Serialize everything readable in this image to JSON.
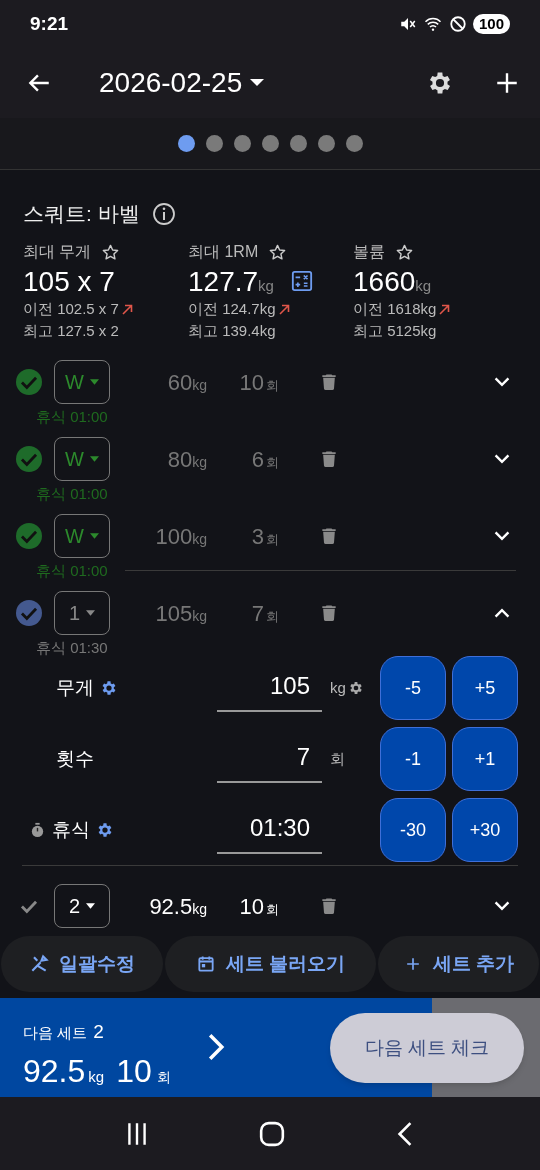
{
  "status_bar": {
    "time": "9:21",
    "battery": "100"
  },
  "app_bar": {
    "date": "2026-02-25"
  },
  "pages": [
    {
      "selected": true
    },
    {
      "selected": false
    },
    {
      "selected": false
    },
    {
      "selected": false
    },
    {
      "selected": false
    },
    {
      "selected": false
    },
    {
      "selected": false
    }
  ],
  "exercise": {
    "title": "스쿼트: 바벨"
  },
  "stats": [
    {
      "label": "최대 무게",
      "value": "105 x 7",
      "calculator": false,
      "previous": "이전 102.5 x 7",
      "best": "최고 127.5 x 2"
    },
    {
      "label": "최대 1RM",
      "value": "127.7",
      "unit": "kg",
      "calculator": true,
      "previous": "이전 124.7kg",
      "best": "최고 139.4kg"
    },
    {
      "label": "볼륨",
      "value": "1660",
      "unit": "kg",
      "calculator": false,
      "previous": "이전 1618kg",
      "best": "최고 5125kg"
    }
  ],
  "sets": [
    {
      "kind": "done",
      "type": "W",
      "weight": "60",
      "weight_unit": "kg",
      "reps": "10",
      "reps_unit": "회",
      "rest": "휴식 01:00",
      "expanded": false
    },
    {
      "kind": "done",
      "type": "W",
      "weight": "80",
      "weight_unit": "kg",
      "reps": "6",
      "reps_unit": "회",
      "rest": "휴식 01:00",
      "expanded": false
    },
    {
      "kind": "done",
      "type": "W",
      "weight": "100",
      "weight_unit": "kg",
      "reps": "3",
      "reps_unit": "회",
      "rest": "휴식 01:00",
      "expanded": false
    },
    {
      "kind": "active",
      "type": "1",
      "weight": "105",
      "weight_unit": "kg",
      "reps": "7",
      "reps_unit": "회",
      "rest": "휴식 01:30",
      "expanded": true
    },
    {
      "kind": "pending",
      "type": "2",
      "weight": "92.5",
      "weight_unit": "kg",
      "reps": "10",
      "reps_unit": "회",
      "expanded": false
    }
  ],
  "editor": [
    {
      "kind": "weight",
      "label": "무게",
      "value": "105",
      "unit": "kg",
      "buttons": [
        "-5",
        "+5"
      ]
    },
    {
      "kind": "reps",
      "label": "횟수",
      "value": "7",
      "unit": "회",
      "buttons": [
        "-1",
        "+1"
      ]
    },
    {
      "kind": "rest",
      "label": "휴식",
      "value": "01:30",
      "buttons": [
        "-30",
        "+30"
      ]
    }
  ],
  "actions": [
    {
      "kind": "bulk",
      "label": "일괄수정"
    },
    {
      "kind": "load",
      "label": "세트 불러오기"
    },
    {
      "kind": "add",
      "label": "세트 추가"
    }
  ],
  "next_set": {
    "label": "다음 세트",
    "number": "2",
    "weight": "92.5",
    "weight_unit": "kg",
    "reps": "10",
    "reps_unit": "회",
    "level": 0.8
  },
  "check_button": "다음 세트 체크"
}
